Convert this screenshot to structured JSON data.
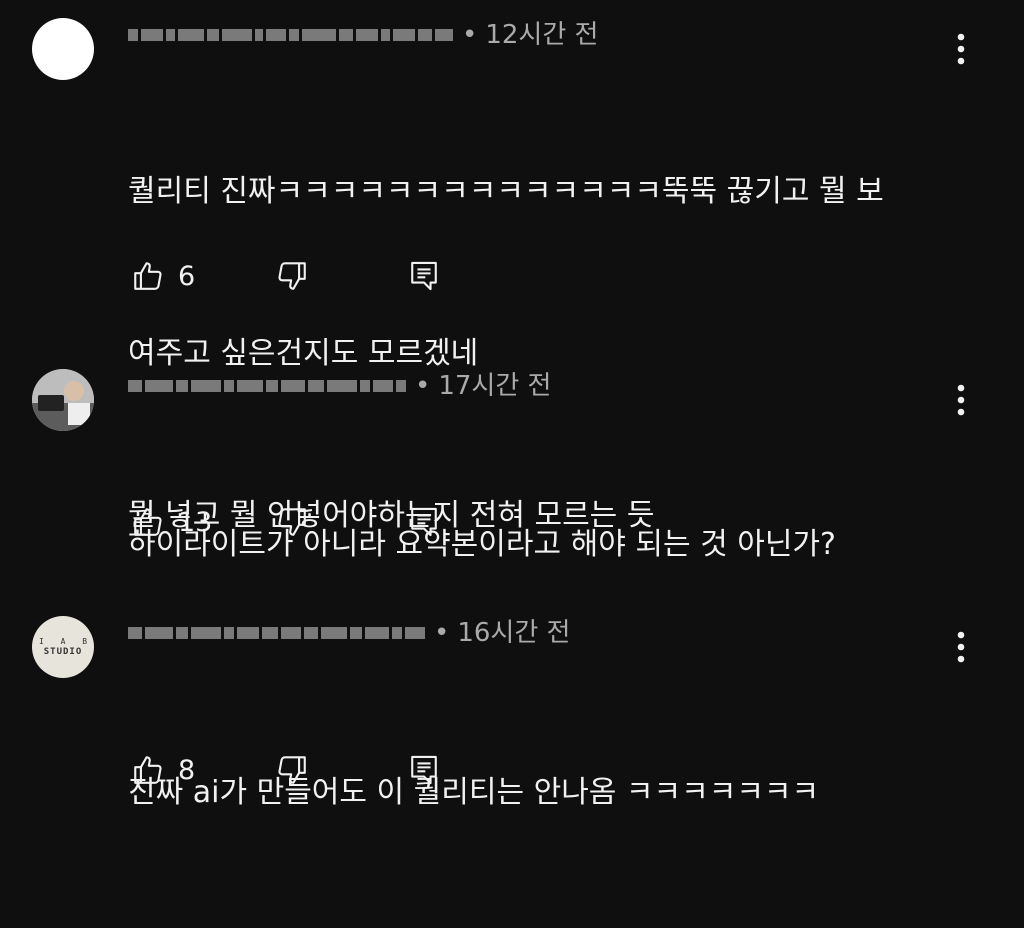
{
  "comments": [
    {
      "author": "",
      "time": "12시간 전",
      "text_lines": [
        "퀄리티 진짜ㅋㅋㅋㅋㅋㅋㅋㅋㅋㅋㅋㅋㅋㅋ뚝뚝 끊기고 뭘 보",
        "여주고 싶은건지도 모르겠네",
        "뭘 넣고 뭘 안넣어야하는지 전혀 모르는 듯"
      ],
      "likes": "6"
    },
    {
      "author": "",
      "time": "17시간 전",
      "text_lines": [
        "하이라이트가 아니라 요약본이라고 해야 되는 것 아닌가?"
      ],
      "likes": "13"
    },
    {
      "author": "",
      "time": "16시간 전",
      "text_lines": [
        "진짜 ai가 만들어도 이 퀄리티는 안나옴 ㅋㅋㅋㅋㅋㅋㅋ"
      ],
      "likes": "8"
    }
  ],
  "avatars": {
    "studio_line1": "I A B",
    "studio_line2": "STUDIO"
  },
  "icons": {
    "like": "thumb-up-icon",
    "dislike": "thumb-down-icon",
    "reply": "reply-icon",
    "more": "more-vert-icon"
  },
  "colors": {
    "background": "#0f0f0f",
    "text": "#f1f1f1",
    "secondary_text": "#aaaaaa"
  }
}
